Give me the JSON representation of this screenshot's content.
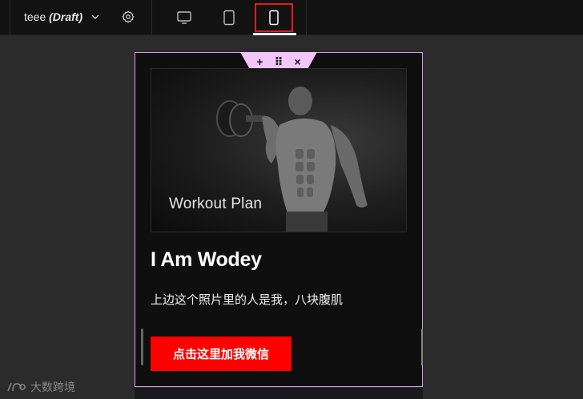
{
  "topbar": {
    "title": "teee",
    "status": "(Draft)",
    "devices": [
      "desktop",
      "tablet",
      "mobile"
    ],
    "active_device": "mobile"
  },
  "section_toolbar": {
    "add": "+",
    "move": "⠿",
    "close": "×"
  },
  "hero": {
    "image_caption": "Workout Plan"
  },
  "content": {
    "headline": "I Am Wodey",
    "subtext": "上边这个照片里的人是我，八块腹肌",
    "cta_label": "点击这里加我微信"
  },
  "watermark": {
    "text": "大数跨境"
  },
  "colors": {
    "accent_red": "#ff0000",
    "selection_outline": "#d99cf0",
    "section_tab": "#f2c6fb"
  }
}
